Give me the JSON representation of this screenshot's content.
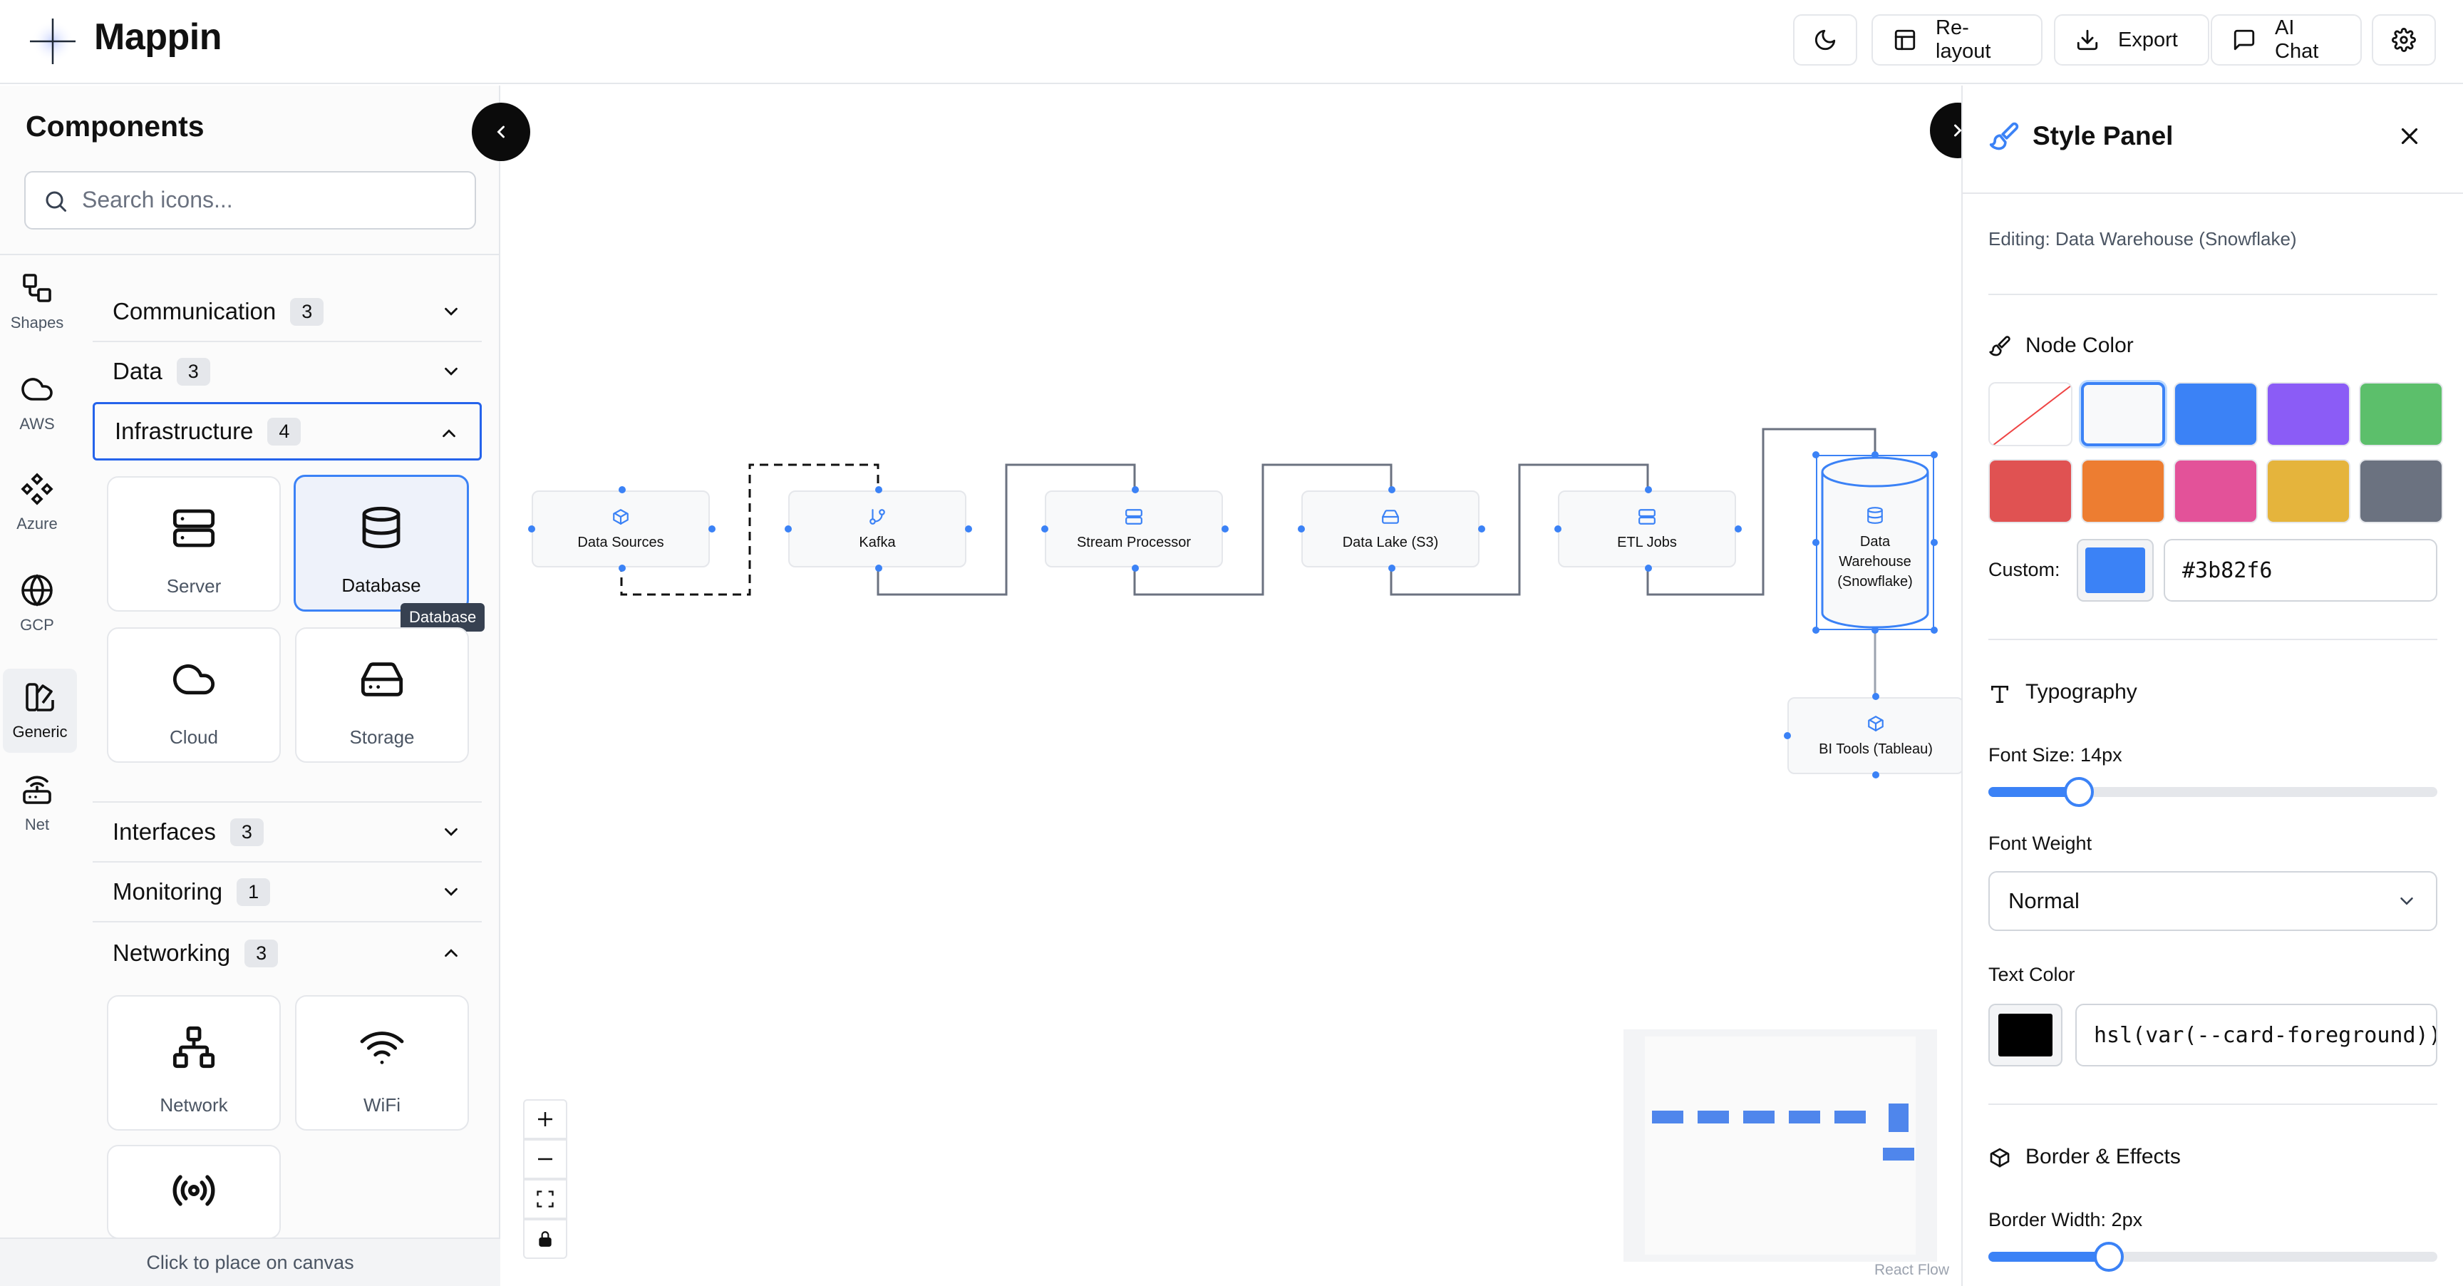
{
  "app": {
    "title": "Mappin"
  },
  "toolbar": {
    "relayout_label": "Re-layout",
    "export_label": "Export",
    "ai_chat_label": "AI Chat"
  },
  "sidebar": {
    "title": "Components",
    "search_placeholder": "Search icons...",
    "rail": [
      {
        "label": "Shapes",
        "icon": "shapes-icon"
      },
      {
        "label": "AWS",
        "icon": "cloud-icon"
      },
      {
        "label": "Azure",
        "icon": "azure-icon"
      },
      {
        "label": "GCP",
        "icon": "globe-icon"
      },
      {
        "label": "Generic",
        "icon": "generic-icon",
        "active": true
      },
      {
        "label": "Net",
        "icon": "router-icon"
      }
    ],
    "categories": [
      {
        "name": "Communication",
        "count": "3",
        "expanded": false
      },
      {
        "name": "Data",
        "count": "3",
        "expanded": false
      },
      {
        "name": "Infrastructure",
        "count": "4",
        "expanded": true
      },
      {
        "name": "Interfaces",
        "count": "3",
        "expanded": false
      },
      {
        "name": "Monitoring",
        "count": "1",
        "expanded": false
      },
      {
        "name": "Networking",
        "count": "3",
        "expanded": true
      }
    ],
    "infrastructure_items": [
      "Server",
      "Database",
      "Cloud",
      "Storage"
    ],
    "networking_items": [
      "Network",
      "WiFi",
      ""
    ],
    "tooltip": "Database",
    "footer": "Click to place on canvas"
  },
  "canvas": {
    "nodes": [
      {
        "label": "Data Sources",
        "icon": "box-icon"
      },
      {
        "label": "Kafka",
        "icon": "git-branch-icon"
      },
      {
        "label": "Stream Processor",
        "icon": "server-icon"
      },
      {
        "label": "Data Lake (S3)",
        "icon": "hard-drive-icon"
      },
      {
        "label": "ETL Jobs",
        "icon": "server-icon"
      },
      {
        "label": "Data Warehouse (Snowflake)",
        "icon": "database-icon",
        "selected": true
      },
      {
        "label": "BI Tools (Tableau)",
        "icon": "box-icon"
      }
    ],
    "attribution": "React Flow"
  },
  "style_panel": {
    "title": "Style Panel",
    "editing_label": "Editing: Data Warehouse (Snowflake)",
    "node_color_label": "Node Color",
    "swatches": [
      "none",
      "#f8f9fa",
      "#3b82f6",
      "#8b5cf6",
      "#5cbf6b",
      "#e05252",
      "#ed7d31",
      "#e35299",
      "#e5b43c",
      "#6b7280"
    ],
    "selected_swatch": "#f8f9fa",
    "custom_label": "Custom:",
    "custom_color": "#3b82f6",
    "custom_value": "#3b82f6",
    "typography_label": "Typography",
    "font_size_label": "Font Size: 14px",
    "font_size_value": 14,
    "font_weight_label": "Font Weight",
    "font_weight_value": "Normal",
    "text_color_label": "Text Color",
    "text_color_swatch": "#000000",
    "text_color_value": "hsl(var(--card-foreground))",
    "border_effects_label": "Border & Effects",
    "border_width_label": "Border Width: 2px",
    "border_width_value": 2
  }
}
